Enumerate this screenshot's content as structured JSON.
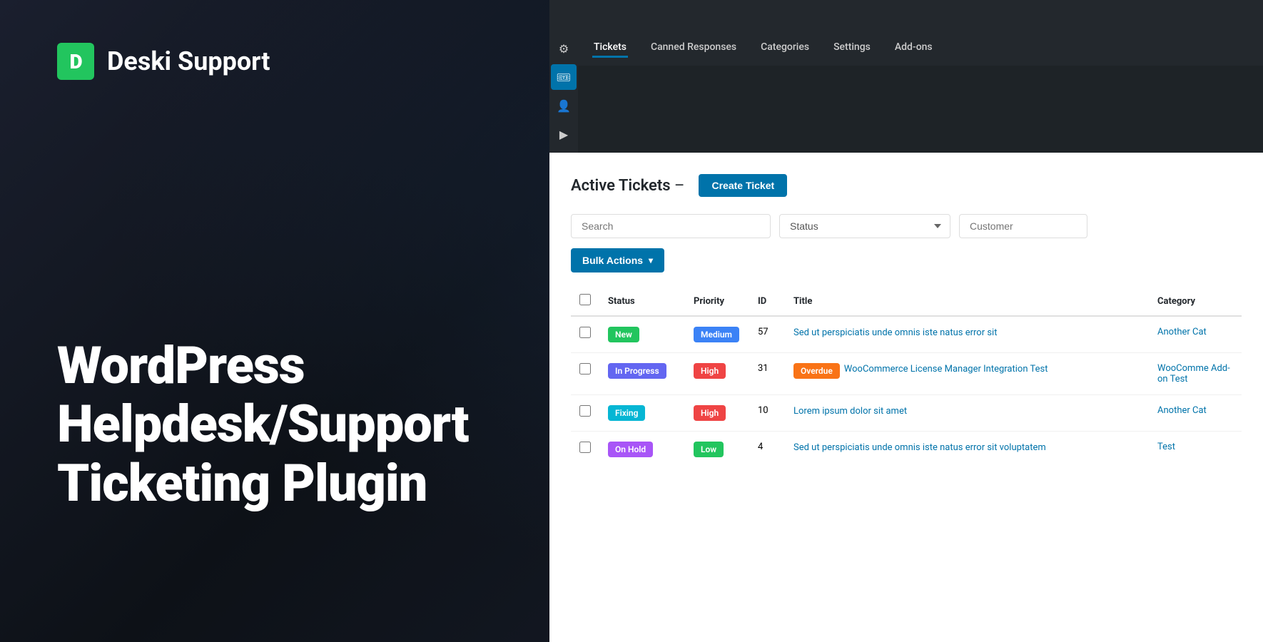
{
  "brand": {
    "logo_letter": "D",
    "name": "Deski Support"
  },
  "hero": {
    "line1": "WordPress",
    "line2": "Helpdesk/Support",
    "line3": "Ticketing Plugin"
  },
  "nav": {
    "icon_titles": [
      "settings",
      "tickets",
      "users",
      "media"
    ],
    "menu_items": [
      {
        "label": "Tickets",
        "active": true
      },
      {
        "label": "Canned Responses",
        "active": false
      },
      {
        "label": "Categories",
        "active": false
      },
      {
        "label": "Settings",
        "active": false
      },
      {
        "label": "Add-ons",
        "active": false
      }
    ]
  },
  "page": {
    "title": "Active Tickets",
    "title_dash": "–",
    "create_button": "Create Ticket"
  },
  "filters": {
    "search_placeholder": "Search",
    "status_placeholder": "Status",
    "customer_placeholder": "Customer"
  },
  "bulk_actions": {
    "label": "Bulk Actions"
  },
  "table": {
    "columns": [
      "",
      "Status",
      "Priority",
      "ID",
      "Title",
      "Category"
    ],
    "rows": [
      {
        "status": "New",
        "status_class": "badge-new",
        "priority": "Medium",
        "priority_class": "badge-medium",
        "id": "57",
        "title": "Sed ut perspiciatis unde omnis iste natus error sit",
        "title_badge": null,
        "category": "Another Cat"
      },
      {
        "status": "In Progress",
        "status_class": "badge-in-progress",
        "priority": "High",
        "priority_class": "badge-high",
        "id": "31",
        "title": "WooCommerce License Manager Integration Test",
        "title_badge": "Overdue",
        "title_badge_class": "badge-overdue",
        "category": "WooComme Add-on Test"
      },
      {
        "status": "Fixing",
        "status_class": "badge-fixing",
        "priority": "High",
        "priority_class": "badge-high",
        "id": "10",
        "title": "Lorem ipsum dolor sit amet",
        "title_badge": null,
        "category": "Another Cat"
      },
      {
        "status": "On Hold",
        "status_class": "badge-on-hold",
        "priority": "Low",
        "priority_class": "badge-low",
        "id": "4",
        "title": "Sed ut perspiciatis unde omnis iste natus error sit voluptatem",
        "title_badge": null,
        "category": "Test"
      }
    ]
  }
}
